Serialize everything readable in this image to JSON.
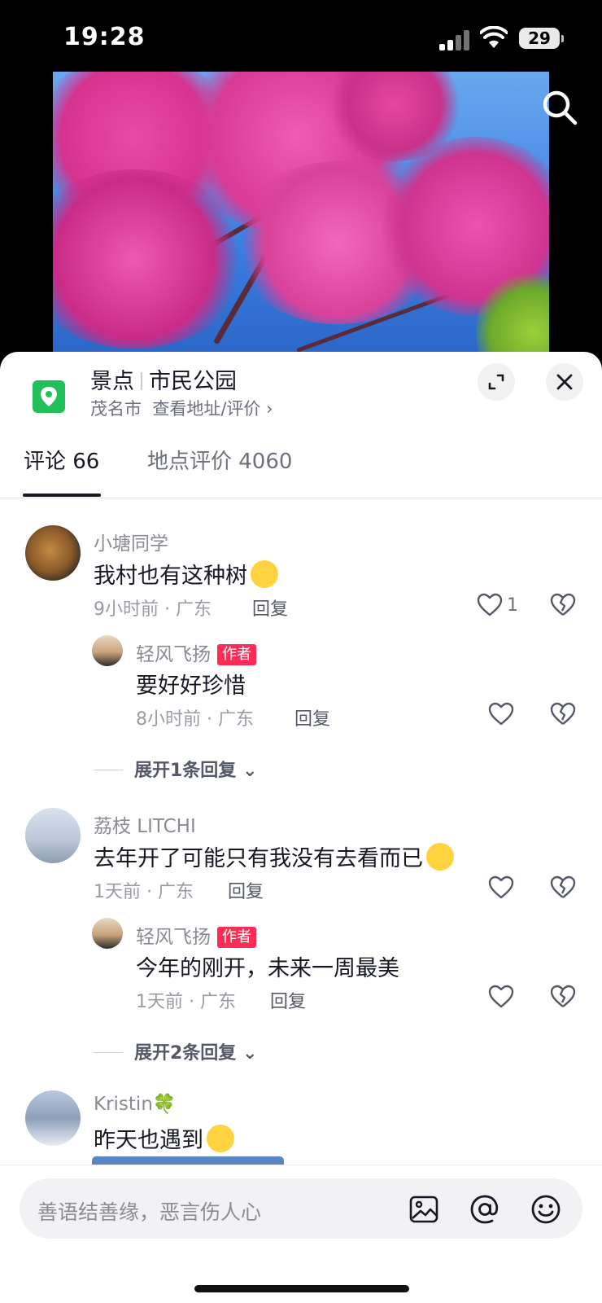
{
  "status_bar": {
    "time": "19:28",
    "battery": "29"
  },
  "place": {
    "category": "景点",
    "name": "市民公园",
    "city": "茂名市",
    "link": "查看地址/评价 ›"
  },
  "tabs": [
    {
      "label": "评论 66"
    },
    {
      "label": "地点评价 4060"
    }
  ],
  "comments": [
    {
      "user": "小塘同学",
      "text": "我村也有这种树",
      "meta": "9小时前 · 广东",
      "reply_label": "回复",
      "likes": "1",
      "replies": [
        {
          "user": "轻风飞扬",
          "badge": "作者",
          "text": "要好好珍惜",
          "meta": "8小时前 · 广东",
          "reply_label": "回复"
        }
      ],
      "expand": "展开1条回复"
    },
    {
      "user": "荔枝 LITCHI",
      "text": "去年开了可能只有我没有去看而已",
      "meta": "1天前 · 广东",
      "reply_label": "回复",
      "replies": [
        {
          "user": "轻风飞扬",
          "badge": "作者",
          "text": "今年的刚开，未来一周最美",
          "meta": "1天前 · 广东",
          "reply_label": "回复"
        }
      ],
      "expand": "展开2条回复"
    },
    {
      "user": "Kristin🍀",
      "text": "昨天也遇到"
    }
  ],
  "input": {
    "placeholder": "善语结善缘，恶言伤人心"
  },
  "colors": {
    "accent": "#fe2c55",
    "pin_green": "#22c05a",
    "text_primary": "#161823",
    "text_secondary": "#8a8b94"
  }
}
